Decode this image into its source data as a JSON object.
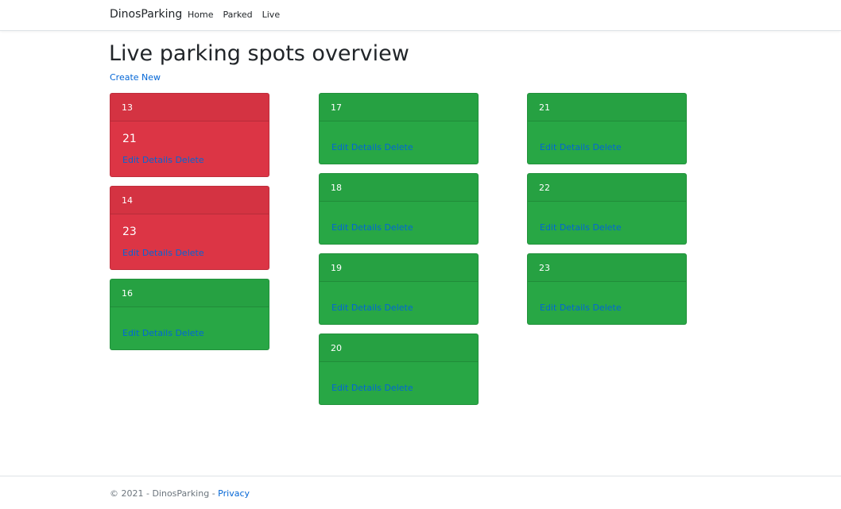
{
  "navbar": {
    "brand": "DinosParking",
    "links": [
      "Home",
      "Parked",
      "Live"
    ]
  },
  "page": {
    "title": "Live parking spots overview",
    "create_link": "Create New"
  },
  "actions": {
    "edit": "Edit",
    "details": "Details",
    "delete": "Delete"
  },
  "colors": {
    "occupied": "#dc3545",
    "free": "#28a745",
    "link": "#0366d6"
  },
  "columns": [
    [
      {
        "spot": "13",
        "status": "occupied",
        "value": "21"
      },
      {
        "spot": "14",
        "status": "occupied",
        "value": "23"
      },
      {
        "spot": "16",
        "status": "free",
        "value": ""
      }
    ],
    [
      {
        "spot": "17",
        "status": "free",
        "value": ""
      },
      {
        "spot": "18",
        "status": "free",
        "value": ""
      },
      {
        "spot": "19",
        "status": "free",
        "value": ""
      },
      {
        "spot": "20",
        "status": "free",
        "value": ""
      }
    ],
    [
      {
        "spot": "21",
        "status": "free",
        "value": ""
      },
      {
        "spot": "22",
        "status": "free",
        "value": ""
      },
      {
        "spot": "23",
        "status": "free",
        "value": ""
      }
    ]
  ],
  "footer": {
    "text": "© 2021 - DinosParking - ",
    "privacy": "Privacy"
  }
}
